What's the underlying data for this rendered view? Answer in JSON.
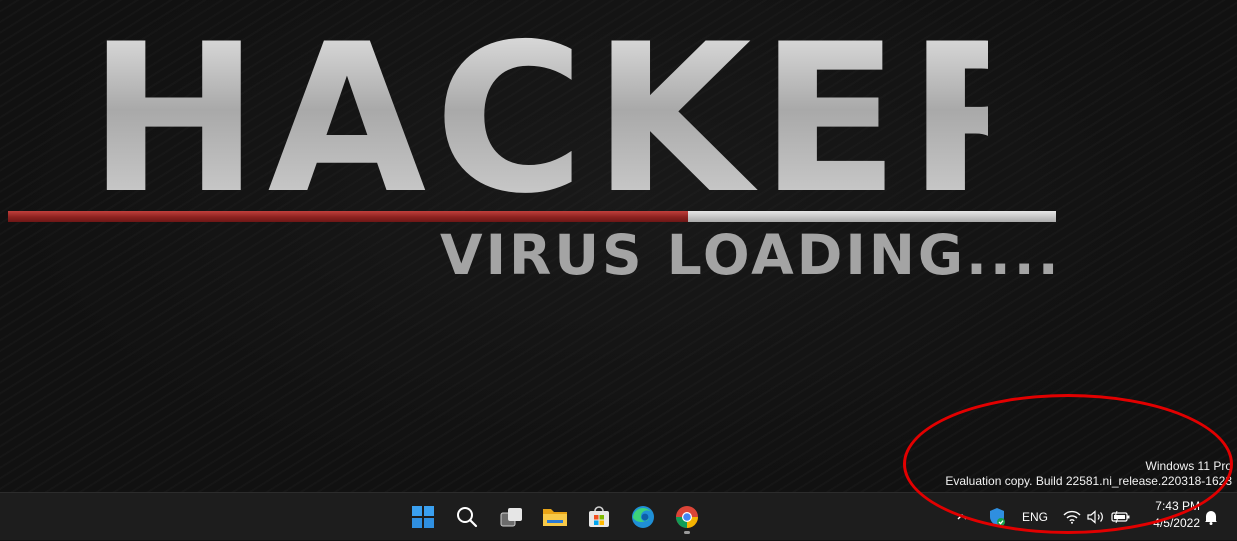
{
  "wallpaper": {
    "title": "HACKER",
    "subtitle": "VIRUS LOADING....",
    "progress_percent": 65
  },
  "watermark": {
    "line1": "Windows 11 Pro",
    "line2": "Evaluation copy. Build 22581.ni_release.220318-1623"
  },
  "taskbar": {
    "apps": [
      {
        "name": "Start",
        "icon": "windows-start-icon"
      },
      {
        "name": "Search",
        "icon": "search-icon"
      },
      {
        "name": "Task View",
        "icon": "task-view-icon"
      },
      {
        "name": "File Explorer",
        "icon": "folder-icon"
      },
      {
        "name": "Microsoft Store",
        "icon": "store-icon"
      },
      {
        "name": "Microsoft Edge",
        "icon": "edge-icon"
      },
      {
        "name": "Google Chrome",
        "icon": "chrome-icon",
        "running": true
      }
    ],
    "tray": {
      "overflow_icon": "chevron-up-icon",
      "security_icon": "windows-security-icon",
      "language": "ENG",
      "wifi_icon": "wifi-icon",
      "volume_icon": "speaker-icon",
      "battery_icon": "battery-icon",
      "time": "7:43 PM",
      "date": "4/5/2022",
      "notification_icon": "notification-bell-icon"
    }
  },
  "annotation": {
    "color": "#e20000"
  },
  "colors": {
    "progress_red": "#a52a27",
    "progress_track": "#cfcfcf",
    "taskbar_bg": "#1d1d1d",
    "windows_blue": "#3aa0f0"
  }
}
